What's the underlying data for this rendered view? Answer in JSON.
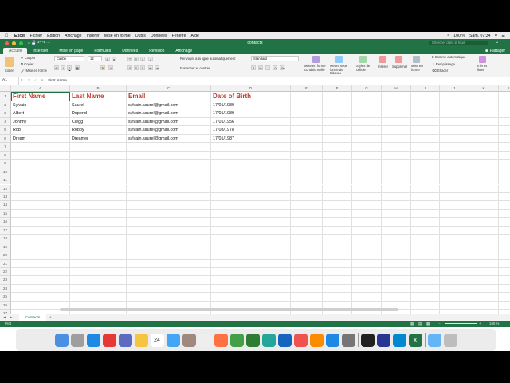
{
  "menubar": {
    "app": "Excel",
    "items": [
      "Fichier",
      "Édition",
      "Affichage",
      "Insérer",
      "Mise en forme",
      "Outils",
      "Données",
      "Fenêtre",
      "Aide"
    ],
    "battery": "100 %",
    "clock": "Sam. 07:34"
  },
  "window": {
    "title": "contacts",
    "search_placeholder": "Chercher dans la feuill"
  },
  "ribbon": {
    "tabs": [
      "Accueil",
      "Insertion",
      "Mise en page",
      "Formules",
      "Données",
      "Révision",
      "Affichage"
    ],
    "share": "Partager",
    "cut": "Couper",
    "copy": "Copier",
    "format_painter": "Mise en forme",
    "paste": "Coller",
    "font_name": "Calibri",
    "font_size": "12",
    "wrap_text": "Renvoyer à la ligne automatiquement",
    "merge": "Fusionner et centrer",
    "number_format": "Standard",
    "conditional": "Mise en forme conditionnelle",
    "table": "Mettre sous forme de tableau",
    "cell_styles": "Styles de cellule",
    "insert": "Insérer",
    "delete": "Supprimer",
    "format": "Mise en forme",
    "autosum": "Somme automatique",
    "fill": "Remplissage",
    "clear": "Effacer",
    "sort": "Trier et filtrer"
  },
  "formula_bar": {
    "cell_ref": "A1",
    "fx": "fx",
    "value": "First Name"
  },
  "columns": [
    "A",
    "B",
    "C",
    "D",
    "E",
    "F",
    "G",
    "H",
    "I",
    "J",
    "K",
    "L"
  ],
  "rows": [
    "1",
    "2",
    "3",
    "4",
    "5",
    "6",
    "7",
    "8",
    "9",
    "10",
    "11",
    "12",
    "13",
    "14",
    "15",
    "16",
    "17",
    "18",
    "19",
    "20",
    "21",
    "22",
    "23",
    "24",
    "25",
    "26",
    "27",
    "28"
  ],
  "table": {
    "headers": [
      "First Name",
      "Last Name",
      "Email",
      "Date of Birth"
    ],
    "records": [
      [
        "Sylvain",
        "Saurel",
        "sylvain.saurel@gmail.com",
        "17/01/1980"
      ],
      [
        "Albert",
        "Dupond",
        "sylvain.saurel@gmail.com",
        "17/01/1989"
      ],
      [
        "Johnny",
        "Clegg",
        "sylvain.saurel@gmail.com",
        "17/01/1956"
      ],
      [
        "Rob",
        "Robby",
        "sylvain.saurel@gmail.com",
        "17/08/1978"
      ],
      [
        "Dream",
        "Dreamer",
        "sylvain.saurel@gmail.com",
        "17/01/1987"
      ]
    ]
  },
  "sheets": {
    "active": "Contacts",
    "add": "+"
  },
  "status": {
    "left": "Prêt",
    "zoom": "100 %"
  },
  "dock_icons": [
    "finder-icon",
    "launchpad-icon",
    "safari-icon",
    "chrome-icon",
    "preview-icon",
    "notes-icon",
    "calendar-icon",
    "mail-icon",
    "contacts-icon",
    "reminders-icon",
    "photos-icon",
    "messages-icon",
    "facetime-icon",
    "numbers-icon",
    "keynote-icon",
    "music-icon",
    "books-icon",
    "appstore-icon",
    "settings-icon",
    "terminal-icon",
    "eclipse-icon",
    "search-icon",
    "excel-icon",
    "folder-icon",
    "trash-icon"
  ],
  "colors": {
    "accent": "#217346",
    "header_text": "#c0392b"
  }
}
